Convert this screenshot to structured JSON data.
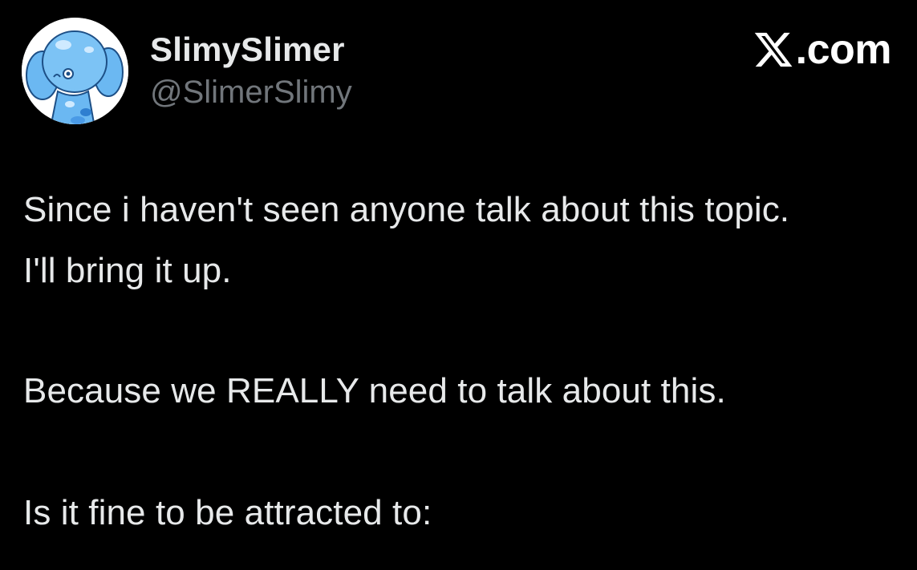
{
  "author": {
    "display_name": "SlimySlimer",
    "handle": "@SlimerSlimy",
    "avatar_icon": "slime-character-avatar"
  },
  "brand": {
    "logo_icon": "x-logo-icon",
    "suffix": ".com"
  },
  "post": {
    "lines": [
      "Since i haven't seen anyone talk about this topic.",
      "I'll bring it up.",
      "Because we REALLY need to talk about this.",
      "Is it fine to be attracted to:"
    ]
  },
  "colors": {
    "background": "#000000",
    "primary_text": "#e7e9ea",
    "secondary_text": "#71767b",
    "avatar_slime": "#5ab0f0"
  }
}
